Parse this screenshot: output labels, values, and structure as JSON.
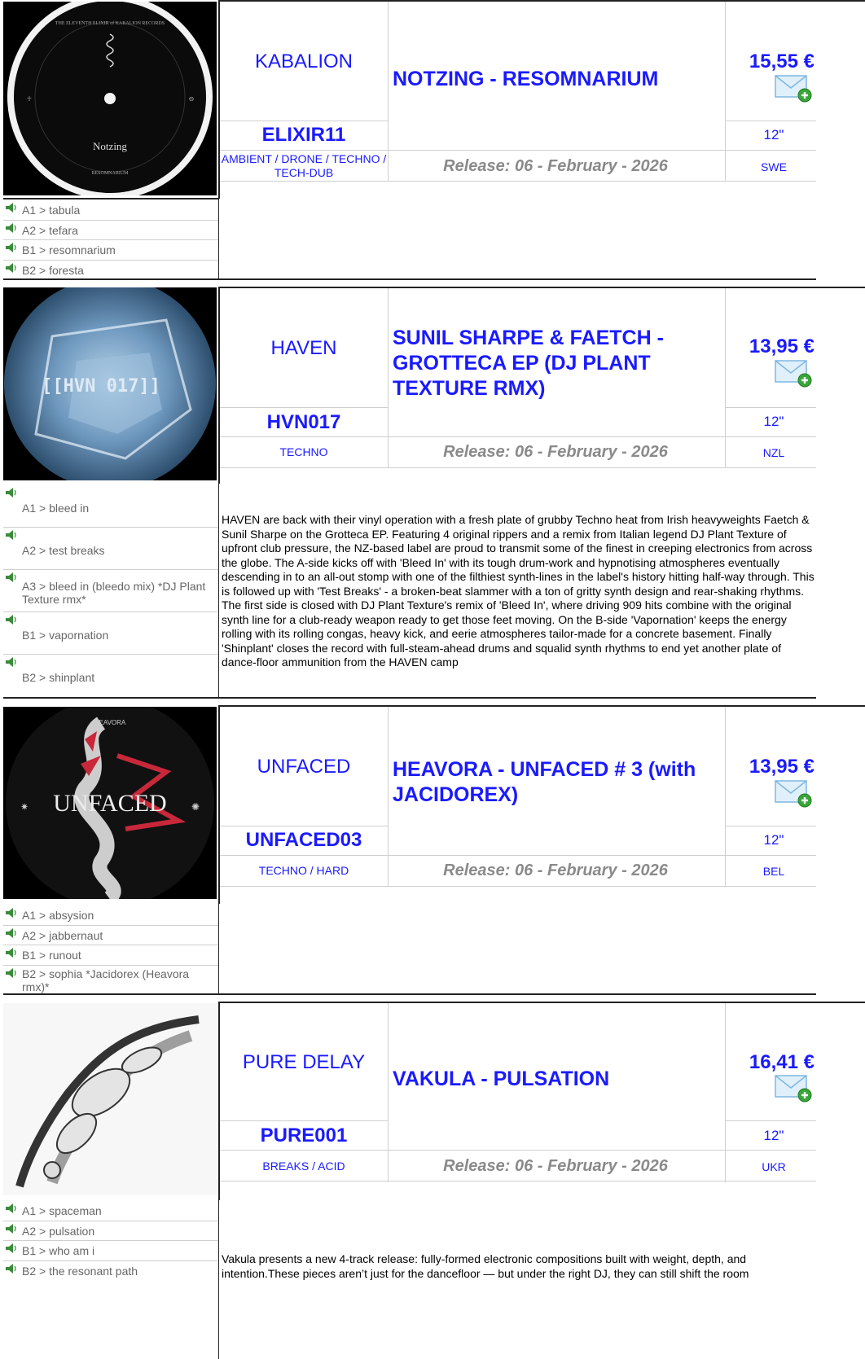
{
  "releases": [
    {
      "label": "KABALION",
      "title": "NOTZING - RESOMNARIUM",
      "price": "15,55 €",
      "catalog": "ELIXIR11",
      "format": "12\"",
      "genre": "AMBIENT / DRONE / TECHNO / TECH-DUB",
      "release": "Release: 06 - February - 2026",
      "country": "SWE",
      "cover_text": [
        "THE ELEVENTH ELIXIR of KABALION RECORDS",
        "Notzing",
        "RESOMNARIUM"
      ],
      "tracks": [
        "A1 > tabula",
        "A2 > tefara",
        "B1 > resomnarium",
        "B2 > foresta"
      ],
      "description": ""
    },
    {
      "label": "HAVEN",
      "title": "SUNIL SHARPE & FAETCH - GROTTECA EP (DJ PLANT TEXTURE RMX)",
      "price": "13,95 €",
      "catalog": "HVN017",
      "format": "12\"",
      "genre": "TECHNO",
      "release": "Release: 06 - February - 2026",
      "country": "NZL",
      "cover_text": [
        "[[HVN 017]]"
      ],
      "tracks": [
        "A1 > bleed in",
        "A2 > test breaks",
        "A3 > bleed in (bleedo mix) *DJ Plant Texture rmx*",
        "B1 > vapornation",
        "B2 > shinplant"
      ],
      "description": "HAVEN are back with their vinyl operation with a fresh plate of grubby Techno heat from Irish heavyweights Faetch & Sunil Sharpe on the Grotteca EP. Featuring 4 original rippers and a remix from Italian legend DJ Plant Texture of upfront club pressure, the NZ-based label are proud to transmit some of the finest in creeping electronics from across the globe. The A-side kicks off with 'Bleed In' with its tough drum-work and hypnotising atmospheres eventually descending in to an all-out stomp with one of the filthiest synth-lines in the label's history hitting half-way through. This is followed up with 'Test Breaks' - a broken-beat slammer with a ton of gritty synth design and rear-shaking rhythms. The first side is closed with DJ Plant Texture's remix of 'Bleed In', where driving 909 hits combine with the original synth line for a club-ready weapon ready to get those feet moving. On the B-side 'Vapornation' keeps the energy rolling with its rolling congas, heavy kick, and eerie atmospheres tailor-made for a concrete basement. Finally 'Shinplant' closes the record with full-steam-ahead drums and squalid synth rhythms to end yet another plate of dance-floor ammunition from the HAVEN camp"
    },
    {
      "label": "UNFACED",
      "title": "HEAVORA - UNFACED # 3 (with JACIDOREX)",
      "price": "13,95 €",
      "catalog": "UNFACED03",
      "format": "12\"",
      "genre": "TECHNO / HARD",
      "release": "Release: 06 - February - 2026",
      "country": "BEL",
      "cover_text": [
        "UNFACED",
        "HEAVORA"
      ],
      "tracks": [
        "A1 > absysion",
        "A2 > jabbernaut",
        "B1 > runout",
        "B2 > sophia *Jacidorex (Heavora rmx)*"
      ],
      "description": ""
    },
    {
      "label": "PURE DELAY",
      "title": "VAKULA - PULSATION",
      "price": "16,41 €",
      "catalog": "PURE001",
      "format": "12\"",
      "genre": "BREAKS / ACID",
      "release": "Release: 06 - February - 2026",
      "country": "UKR",
      "cover_text": [],
      "tracks": [
        "A1 > spaceman",
        "A2 > pulsation",
        "B1 > who am i",
        "B2 > the resonant path"
      ],
      "description": "Vakula presents a new 4-track release: fully-formed electronic compositions built with weight, depth, and intention.These pieces aren’t just for the dancefloor — but under the right DJ, they can still shift the room"
    }
  ],
  "icons": {
    "speaker": "speaker-icon",
    "mail": "email-add-icon"
  },
  "colors": {
    "link": "#1a1aff",
    "muted": "#8a8a8a"
  }
}
